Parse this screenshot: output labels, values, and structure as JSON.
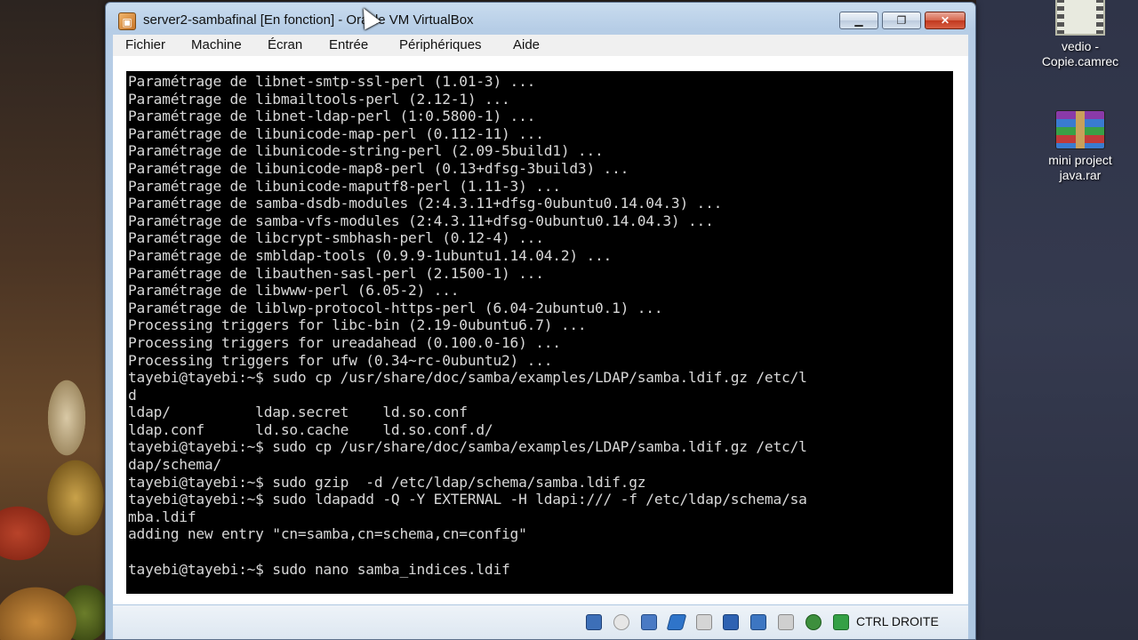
{
  "window": {
    "title": "server2-sambafinal [En fonction] - Oracle VM VirtualBox",
    "minimize_label": "▁",
    "maximize_label": "❐",
    "close_label": "✕"
  },
  "menu": [
    "Fichier",
    "Machine",
    "Écran",
    "Entrée",
    "Périphériques",
    "Aide"
  ],
  "console": {
    "lines": [
      "Paramétrage de libnet-smtp-ssl-perl (1.01-3) ...",
      "Paramétrage de libmailtools-perl (2.12-1) ...",
      "Paramétrage de libnet-ldap-perl (1:0.5800-1) ...",
      "Paramétrage de libunicode-map-perl (0.112-11) ...",
      "Paramétrage de libunicode-string-perl (2.09-5build1) ...",
      "Paramétrage de libunicode-map8-perl (0.13+dfsg-3build3) ...",
      "Paramétrage de libunicode-maputf8-perl (1.11-3) ...",
      "Paramétrage de samba-dsdb-modules (2:4.3.11+dfsg-0ubuntu0.14.04.3) ...",
      "Paramétrage de samba-vfs-modules (2:4.3.11+dfsg-0ubuntu0.14.04.3) ...",
      "Paramétrage de libcrypt-smbhash-perl (0.12-4) ...",
      "Paramétrage de smbldap-tools (0.9.9-1ubuntu1.14.04.2) ...",
      "Paramétrage de libauthen-sasl-perl (2.1500-1) ...",
      "Paramétrage de libwww-perl (6.05-2) ...",
      "Paramétrage de liblwp-protocol-https-perl (6.04-2ubuntu0.1) ...",
      "Processing triggers for libc-bin (2.19-0ubuntu6.7) ...",
      "Processing triggers for ureadahead (0.100.0-16) ...",
      "Processing triggers for ufw (0.34~rc-0ubuntu2) ...",
      "tayebi@tayebi:~$ sudo cp /usr/share/doc/samba/examples/LDAP/samba.ldif.gz /etc/l",
      "d",
      "ldap/          ldap.secret    ld.so.conf",
      "ldap.conf      ld.so.cache    ld.so.conf.d/",
      "tayebi@tayebi:~$ sudo cp /usr/share/doc/samba/examples/LDAP/samba.ldif.gz /etc/l",
      "dap/schema/",
      "tayebi@tayebi:~$ sudo gzip  -d /etc/ldap/schema/samba.ldif.gz",
      "tayebi@tayebi:~$ sudo ldapadd -Q -Y EXTERNAL -H ldapi:/// -f /etc/ldap/schema/sa",
      "mba.ldif",
      "adding new entry \"cn=samba,cn=schema,cn=config\"",
      "",
      "tayebi@tayebi:~$ sudo nano samba_indices.ldif"
    ]
  },
  "statusbar": {
    "host_key": "CTRL DROITE",
    "icons": [
      "harddisk-icon",
      "optical-drive-icon",
      "network-icon",
      "usb-icon",
      "shared-folder-icon",
      "display-icon",
      "video-capture-icon",
      "mouse-integration-icon",
      "keyboard-capture-icon",
      "download-icon"
    ]
  },
  "desktop": {
    "icons": [
      {
        "label": "vedio - Copie.camrec"
      },
      {
        "label": "mini project java.rar"
      }
    ]
  }
}
